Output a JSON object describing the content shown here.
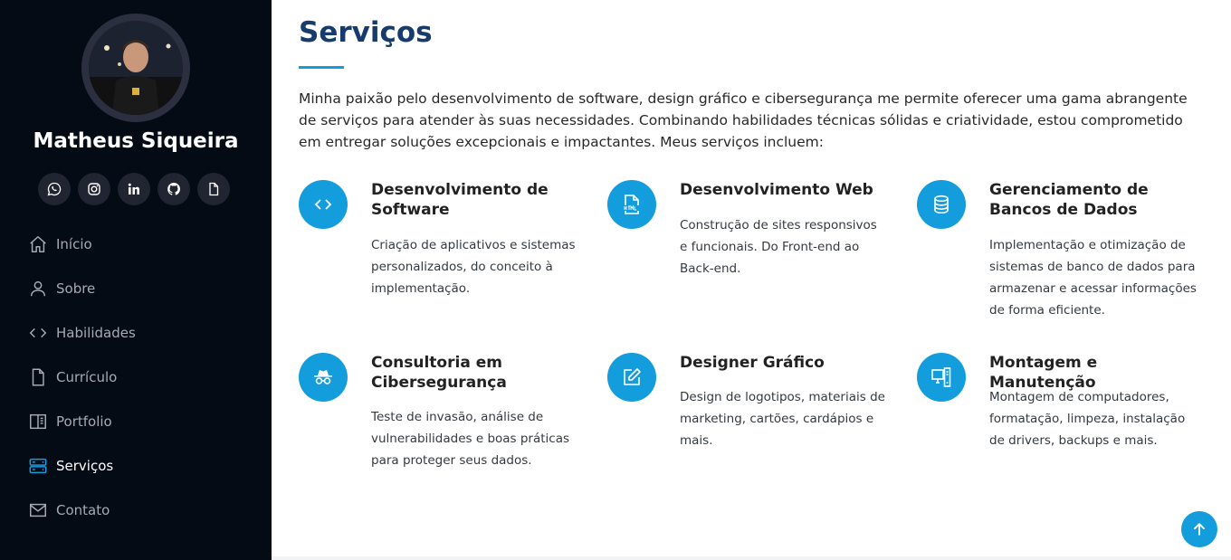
{
  "profile": {
    "name": "Matheus Siqueira"
  },
  "social": [
    {
      "icon": "whatsapp-icon"
    },
    {
      "icon": "instagram-icon"
    },
    {
      "icon": "linkedin-icon"
    },
    {
      "icon": "github-icon"
    },
    {
      "icon": "document-icon"
    }
  ],
  "nav": {
    "items": [
      {
        "label": "Início",
        "icon": "home-icon"
      },
      {
        "label": "Sobre",
        "icon": "person-icon"
      },
      {
        "label": "Habilidades",
        "icon": "code-icon"
      },
      {
        "label": "Currículo",
        "icon": "file-icon"
      },
      {
        "label": "Portfolio",
        "icon": "book-icon"
      },
      {
        "label": "Serviços",
        "icon": "server-icon",
        "active": true
      },
      {
        "label": "Contato",
        "icon": "envelope-icon"
      }
    ]
  },
  "services_section": {
    "title": "Serviços",
    "intro": "Minha paixão pelo desenvolvimento de software, design gráfico e cibersegurança me permite oferecer uma gama abrangente de serviços para atender às suas necessidades. Combinando habilidades técnicas sólidas e criatividade, estou comprometido em entregar soluções excepcionais e impactantes. Meus serviços incluem:",
    "items": [
      {
        "title": "Desenvolvimento de Software",
        "description": "Criação de aplicativos e sistemas personalizados, do conceito à implementação.",
        "icon": "code-icon"
      },
      {
        "title": "Desenvolvimento Web",
        "description": "Construção de sites responsivos e funcionais. Do Front-end ao Back-end.",
        "icon": "html-file-icon"
      },
      {
        "title": "Gerenciamento de Bancos de Dados",
        "description": "Implementação e otimização de sistemas de banco de dados para armazenar e acessar informações de forma eficiente.",
        "icon": "database-icon"
      },
      {
        "title": "Consultoria em Cibersegurança",
        "description": "Teste de invasão, análise de vulnerabilidades e boas práticas para proteger seus dados.",
        "icon": "incognito-icon"
      },
      {
        "title": "Designer Gráfico",
        "description": "Design de logotipos, materiais de marketing, cartões, cardápios e mais.",
        "icon": "pencil-square-icon"
      },
      {
        "title": "Montagem e Manutenção",
        "description": "Montagem de computadores, formatação, limpeza, instalação de drivers, backups e mais.",
        "icon": "pc-display-icon"
      }
    ]
  },
  "colors": {
    "accent": "#149ddd",
    "sidebar_bg": "#040b14",
    "title": "#173b6c",
    "nav_text": "#a8a9b4"
  }
}
